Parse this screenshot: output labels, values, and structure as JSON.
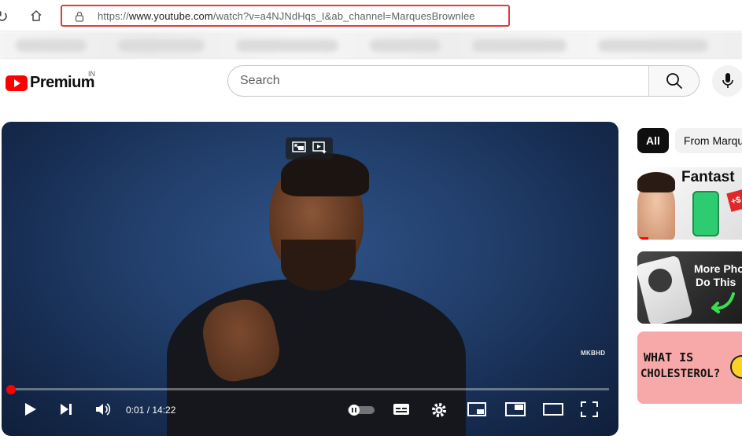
{
  "browser": {
    "url_prefix": "https://",
    "url_domain": "www.youtube.com",
    "url_path": "/watch?v=a4NJNdHqs_I&ab_channel=MarquesBrownlee"
  },
  "header": {
    "logo_text": "Premium",
    "region": "IN",
    "search_placeholder": "Search"
  },
  "player": {
    "watermark": "MKBHD",
    "current_time": "0:01",
    "duration": "14:22",
    "time_separator": " / ",
    "progress_fraction": 0.0012
  },
  "sidebar": {
    "chips": [
      {
        "label": "All",
        "active": true
      },
      {
        "label": "From Marqu",
        "active": false
      }
    ],
    "thumbnails": [
      {
        "text": "Fantast",
        "badge": "+$"
      },
      {
        "text_line1": "More Pho",
        "text_line2": "Do This"
      },
      {
        "text_line1": "WHAT IS",
        "text_line2": "CHOLESTEROL?"
      }
    ]
  },
  "colors": {
    "brand_red": "#ff0000",
    "url_highlight": "#e03b3b"
  }
}
